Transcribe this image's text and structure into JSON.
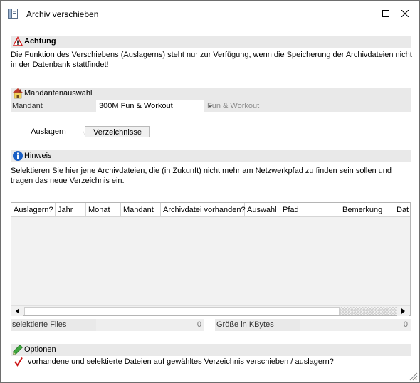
{
  "window": {
    "title": "Archiv verschieben",
    "icon": "archive-window-icon",
    "controls": [
      "minimize-icon",
      "maximize-icon",
      "close-icon"
    ]
  },
  "warning": {
    "title": "Achtung",
    "icon": "warning-triangle-icon",
    "text": "Die Funktion des Verschiebens (Auslagerns) steht nur zur Verfügung, wenn die Speicherung der Archivdateien nicht in der Datenbank stattfindet!"
  },
  "mandant_section": {
    "title": "Mandantenauswahl",
    "icon": "house-icon",
    "label": "Mandant",
    "value": "300M Fun & Workout",
    "description": "Fun & Workout"
  },
  "tabs": [
    {
      "label": "Auslagern",
      "active": true
    },
    {
      "label": "Verzeichnisse",
      "active": false
    }
  ],
  "hint": {
    "title": "Hinweis",
    "icon": "info-icon",
    "text": "Selektieren Sie hier jene Archivdateien, die (in Zukunft) nicht mehr am Netzwerkpfad zu finden sein sollen und tragen das neue Verzeichnis ein."
  },
  "table": {
    "columns": [
      "Auslagern?",
      "Jahr",
      "Monat",
      "Mandant",
      "Archivdatei vorhanden?",
      "Auswahl",
      "Pfad",
      "Bemerkung",
      "Dat"
    ],
    "rows": []
  },
  "stats": {
    "selected_files_label": "selektierte Files",
    "selected_files_value": "0",
    "size_label": "Größe in KBytes",
    "size_value": "0"
  },
  "options": {
    "title": "Optionen",
    "icon": "pencil-icon",
    "checkbox_label": "vorhandene und selektierte Dateien auf gewähltes Verzeichnis verschieben / auslagern?",
    "checked": true
  },
  "colors": {
    "section_bar": "#e9e9e9",
    "warning_red": "#d21f1f",
    "info_blue": "#1a5fc4",
    "check_red": "#cc1414"
  }
}
